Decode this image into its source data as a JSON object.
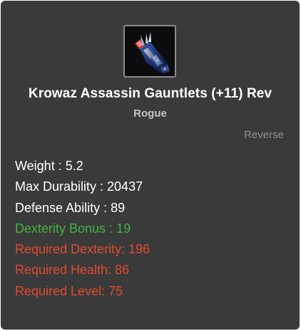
{
  "item": {
    "name": "Krowaz Assassin Gauntlets (+11) Rev",
    "class": "Rogue",
    "tag": "Reverse",
    "icon": "gauntlet-icon"
  },
  "stats": [
    {
      "label": "Weight : 5.2",
      "color": "#ffffff"
    },
    {
      "label": "Max Durability : 20437",
      "color": "#ffffff"
    },
    {
      "label": "Defense Ability : 89",
      "color": "#ffffff"
    },
    {
      "label": "Dexterity Bonus : 19",
      "color": "#3fb53f"
    },
    {
      "label": "Required Dexterity: 196",
      "color": "#e04b2f"
    },
    {
      "label": "Required Health: 86",
      "color": "#e04b2f"
    },
    {
      "label": "Required Level: 75",
      "color": "#e04b2f"
    }
  ],
  "colors": {
    "panel_background": "#3a3a3a",
    "stat_default": "#ffffff",
    "stat_bonus": "#3fb53f",
    "stat_requirement": "#e04b2f",
    "tag": "#8a8f96"
  }
}
